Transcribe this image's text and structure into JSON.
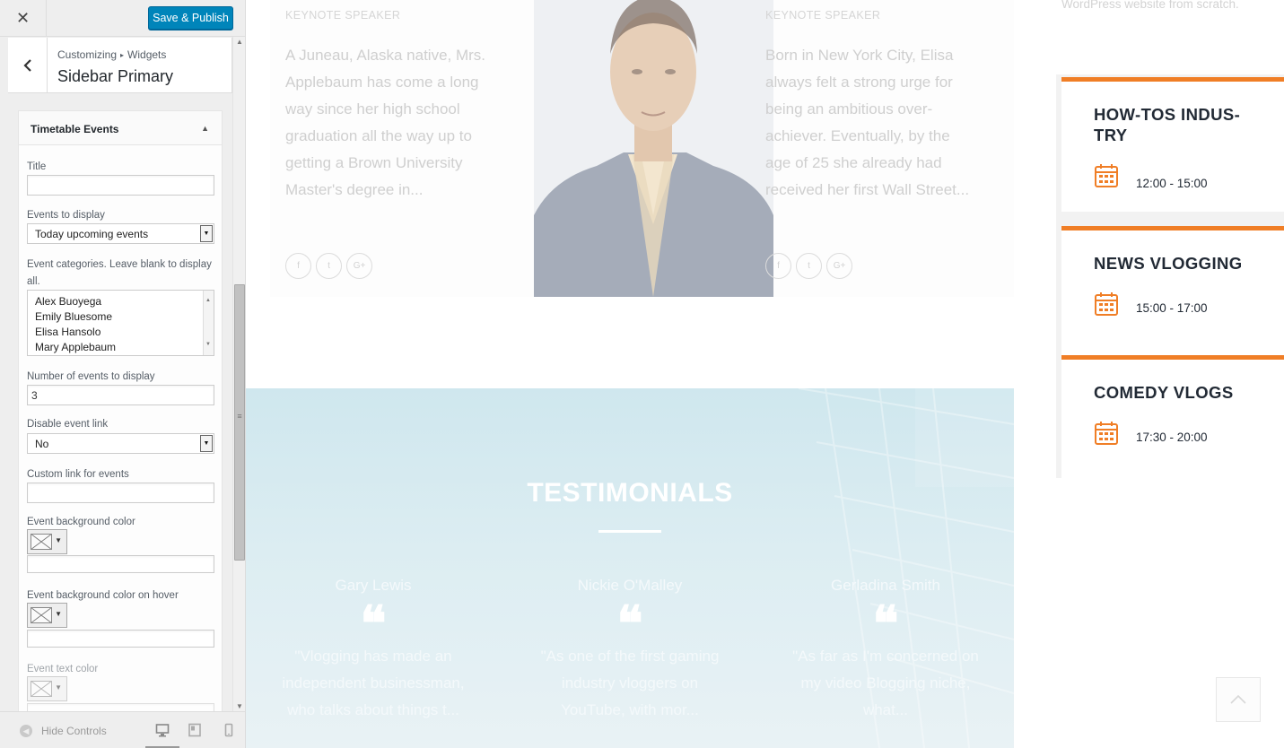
{
  "customizer": {
    "close_icon": "close-icon",
    "publish_label": "Save & Publish",
    "breadcrumb": {
      "parent": "Customizing",
      "separator": "▸",
      "child": "Widgets"
    },
    "section_title": "Sidebar Primary",
    "widget": {
      "title": "Timetable Events",
      "fields": {
        "title_label": "Title",
        "title_value": "",
        "events_label": "Events to display",
        "events_value": "Today upcoming events",
        "categories_label": "Event categories. Leave blank to display all.",
        "categories": [
          "Alex Buoyega",
          "Emily Bluesome",
          "Elisa Hansolo",
          "Mary Applebaum"
        ],
        "number_label": "Number of events to display",
        "number_value": "3",
        "disable_link_label": "Disable event link",
        "disable_link_value": "No",
        "custom_link_label": "Custom link for events",
        "custom_link_value": "",
        "bg_color_label": "Event background color",
        "bg_color_hover_label": "Event background color on hover",
        "text_color_label": "Event text color"
      }
    },
    "footer": {
      "hide_controls": "Hide Controls",
      "devices": [
        "desktop-icon",
        "tablet-icon",
        "mobile-icon"
      ]
    }
  },
  "preview": {
    "speakers": [
      {
        "label": "KEYNOTE SPEAKER",
        "bio": "A Juneau, Alaska native, Mrs. Applebaum has come a long way since her high school graduation all the way up to getting a Brown University Master's degree in..."
      },
      {
        "label": "KEYNOTE SPEAKER",
        "bio": "Born in New York City, Elisa always felt a strong urge for being an ambitious over-achiever. Eventually, by the age of 25 she already had received her first Wall Street..."
      }
    ],
    "social_icons": [
      "f",
      "t",
      "G+"
    ],
    "sidebar_text": "WordPress website from scratch.",
    "testimonials": {
      "title": "TESTIMONIALS",
      "items": [
        {
          "name": "Gary Lewis",
          "quote": "\"Vlogging has made an independent businessman, who talks about things t..."
        },
        {
          "name": "Nickie O'Malley",
          "quote": "\"As one of the first gaming industry vloggers on YouTube, with mor..."
        },
        {
          "name": "Gerladina Smith",
          "quote": "\"As far as I'm concerned on my video Blogging niche, what..."
        }
      ]
    },
    "events": [
      {
        "title": "HOW-TOS INDUS-TRY",
        "time": "12:00 - 15:00"
      },
      {
        "title": "NEWS VLOGGING",
        "time": "15:00 - 17:00"
      },
      {
        "title": "COMEDY VLOGS",
        "time": "17:30 - 20:00"
      }
    ],
    "accent_color": "#f07e26"
  },
  "colors": {
    "publish_button": "#0085ba",
    "event_accent": "#f07e26"
  }
}
